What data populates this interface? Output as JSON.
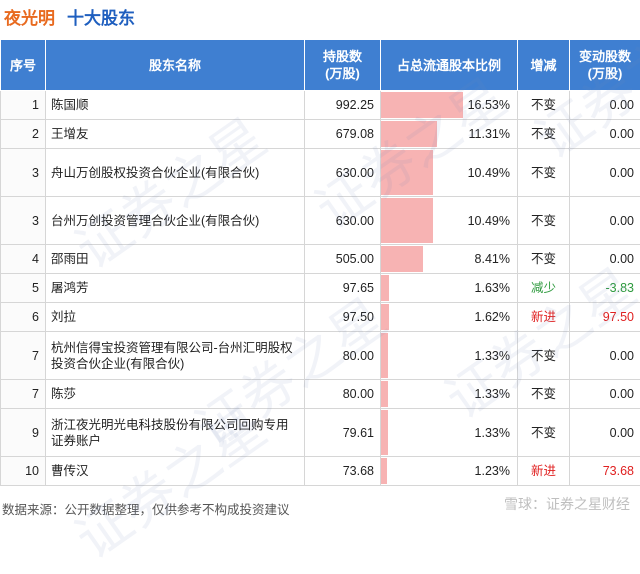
{
  "title": {
    "company": "夜光明",
    "section": "十大股东"
  },
  "headers": {
    "rank": "序号",
    "name": "股东名称",
    "shares": "持股数\n(万股)",
    "ratio": "占总流通股本比例",
    "change": "增减",
    "delta": "变动股数\n(万股)"
  },
  "rows": [
    {
      "rank": "1",
      "name": "陈国顺",
      "shares": "992.25",
      "ratio": "16.53%",
      "ratio_value": 16.53,
      "change": "不变",
      "change_color": "#222222",
      "delta": "0.00",
      "delta_color": "#222222",
      "tall": false
    },
    {
      "rank": "2",
      "name": "王增友",
      "shares": "679.08",
      "ratio": "11.31%",
      "ratio_value": 11.31,
      "change": "不变",
      "change_color": "#222222",
      "delta": "0.00",
      "delta_color": "#222222",
      "tall": false
    },
    {
      "rank": "3",
      "name": "舟山万创股权投资合伙企业(有限合伙)",
      "shares": "630.00",
      "ratio": "10.49%",
      "ratio_value": 10.49,
      "change": "不变",
      "change_color": "#222222",
      "delta": "0.00",
      "delta_color": "#222222",
      "tall": true
    },
    {
      "rank": "3",
      "name": "台州万创投资管理合伙企业(有限合伙)",
      "shares": "630.00",
      "ratio": "10.49%",
      "ratio_value": 10.49,
      "change": "不变",
      "change_color": "#222222",
      "delta": "0.00",
      "delta_color": "#222222",
      "tall": true
    },
    {
      "rank": "4",
      "name": "邵雨田",
      "shares": "505.00",
      "ratio": "8.41%",
      "ratio_value": 8.41,
      "change": "不变",
      "change_color": "#222222",
      "delta": "0.00",
      "delta_color": "#222222",
      "tall": false
    },
    {
      "rank": "5",
      "name": "屠鸿芳",
      "shares": "97.65",
      "ratio": "1.63%",
      "ratio_value": 1.63,
      "change": "减少",
      "change_color": "#2e9a3e",
      "delta": "-3.83",
      "delta_color": "#2e9a3e",
      "tall": false
    },
    {
      "rank": "6",
      "name": "刘拉",
      "shares": "97.50",
      "ratio": "1.62%",
      "ratio_value": 1.62,
      "change": "新进",
      "change_color": "#e02020",
      "delta": "97.50",
      "delta_color": "#e02020",
      "tall": false
    },
    {
      "rank": "7",
      "name": "杭州信得宝投资管理有限公司-台州汇明股权投资合伙企业(有限合伙)",
      "shares": "80.00",
      "ratio": "1.33%",
      "ratio_value": 1.33,
      "change": "不变",
      "change_color": "#222222",
      "delta": "0.00",
      "delta_color": "#222222",
      "tall": true
    },
    {
      "rank": "7",
      "name": "陈莎",
      "shares": "80.00",
      "ratio": "1.33%",
      "ratio_value": 1.33,
      "change": "不变",
      "change_color": "#222222",
      "delta": "0.00",
      "delta_color": "#222222",
      "tall": false
    },
    {
      "rank": "9",
      "name": "浙江夜光明光电科技股份有限公司回购专用证券账户",
      "shares": "79.61",
      "ratio": "1.33%",
      "ratio_value": 1.33,
      "change": "不变",
      "change_color": "#222222",
      "delta": "0.00",
      "delta_color": "#222222",
      "tall": true
    },
    {
      "rank": "10",
      "name": "曹传汉",
      "shares": "73.68",
      "ratio": "1.23%",
      "ratio_value": 1.23,
      "change": "新进",
      "change_color": "#e02020",
      "delta": "73.68",
      "delta_color": "#e02020",
      "tall": false
    }
  ],
  "ratio_bar_color": "#f7b3b3",
  "ratio_max": 16.53,
  "footer": "数据来源：公开数据整理，仅供参考不构成投资建议",
  "logo": "雪球：证券之星财经",
  "watermark": "证券之星"
}
